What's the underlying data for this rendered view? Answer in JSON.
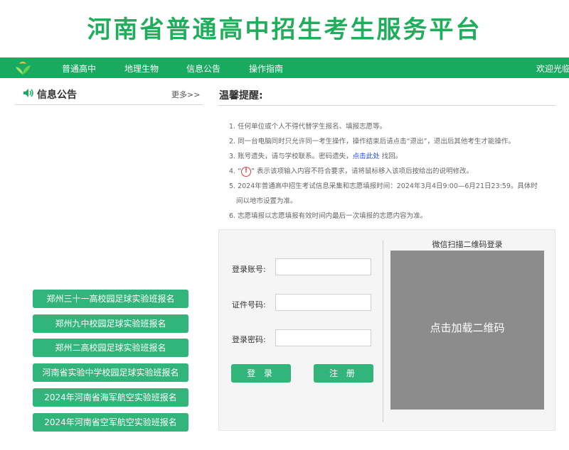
{
  "header": {
    "title": "河南省普通高中招生考生服务平台"
  },
  "nav": {
    "items": [
      "普通高中",
      "地理生物",
      "信息公告",
      "操作指南"
    ],
    "welcome": "欢迎光临"
  },
  "sidebar": {
    "title": "信息公告",
    "more": "更多>>",
    "buttons": [
      "郑州三十一高校园足球实验班报名",
      "郑州九中校园足球实验班报名",
      "郑州二高校园足球实验班报名",
      "河南省实验中学校园足球实验班报名",
      "2024年河南省海军航空实验班报名",
      "2024年河南省空军航空实验班报名"
    ]
  },
  "notice": {
    "title": "温馨提醒:",
    "items": {
      "t1": "1. 任何单位或个人不得代替学生报名、填报志愿等。",
      "t2": "2. 同一台电脑同时只允许同一考生操作，操作结束后请点击“退出”，退出后其他考生才能操作。",
      "t3_pre": "3. 账号遗失，请与学校联系。密码遗失，",
      "t3_link": "点击此处",
      "t3_post": " 找回。",
      "t4_pre": "4. “",
      "t4_icon": "!",
      "t4_post": "” 表示该项输入内容不符合要求，请将鼠标移入该项后按给出的说明修改。",
      "t5a": "5. 2024年普通高中招生考试信息采集和志愿填报时间：2024年3月4日9:00—6月21日23:59。具体时",
      "t5b": "间以地市设置为准。",
      "t6": "6. 志愿填报以志愿填报有效时间内最后一次填报的志愿内容为准。"
    }
  },
  "login": {
    "account_label": "登录账号:",
    "id_label": "证件号码:",
    "password_label": "登录密码:",
    "login_button": "登 录",
    "register_button": "注 册",
    "qr_title": "微信扫描二维码登录",
    "qr_text": "点击加载二维码"
  },
  "colors": {
    "brand": "#19a95f",
    "button": "#32b57a",
    "qr_bg": "#8c8c8c"
  }
}
